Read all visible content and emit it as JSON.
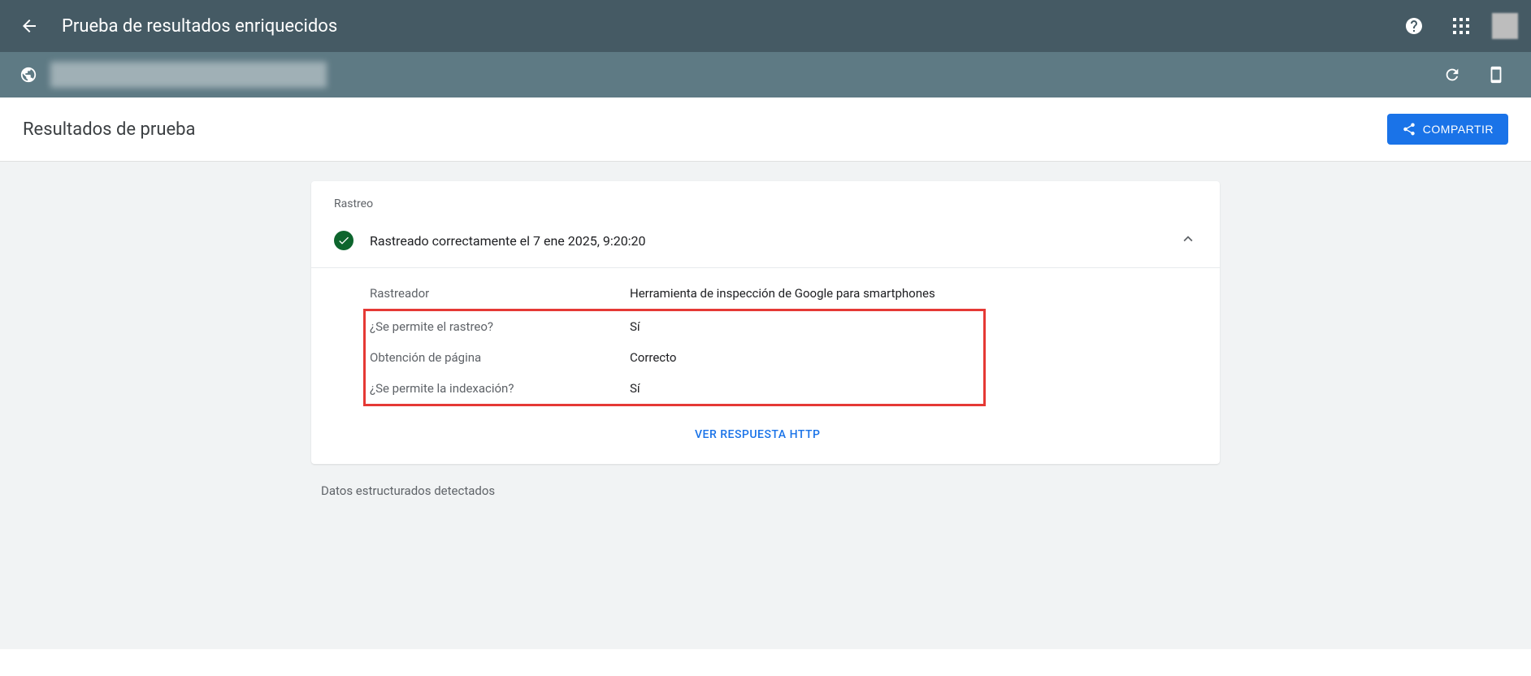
{
  "header": {
    "title": "Prueba de resultados enriquecidos"
  },
  "subheader": {
    "title": "Resultados de prueba",
    "share_label": "COMPARTIR"
  },
  "crawl": {
    "section_label": "Rastreo",
    "status_text": "Rastreado correctamente el 7 ene 2025, 9:20:20",
    "rows": [
      {
        "label": "Rastreador",
        "value": "Herramienta de inspección de Google para smartphones"
      },
      {
        "label": "¿Se permite el rastreo?",
        "value": "Sí"
      },
      {
        "label": "Obtención de página",
        "value": "Correcto"
      },
      {
        "label": "¿Se permite la indexación?",
        "value": "Sí"
      }
    ],
    "http_link": "VER RESPUESTA HTTP"
  },
  "structured_data": {
    "label": "Datos estructurados detectados"
  }
}
